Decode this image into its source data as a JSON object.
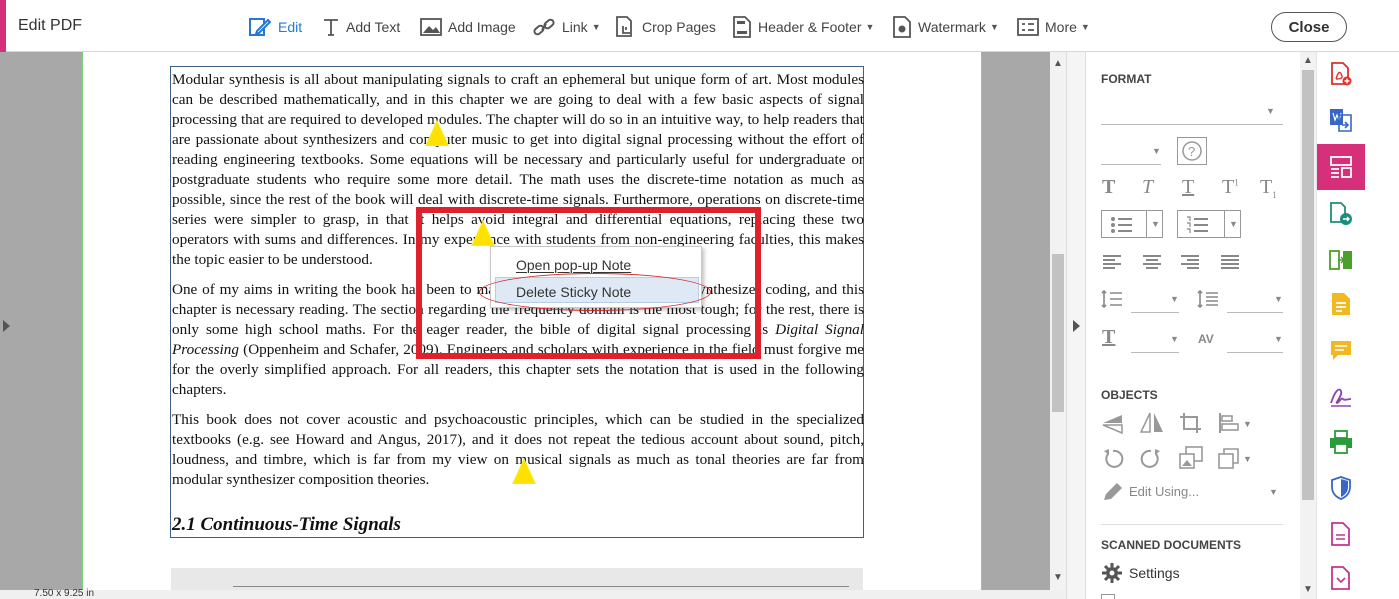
{
  "app": {
    "title": "Edit PDF"
  },
  "toolbar": {
    "edit": "Edit",
    "add_text": "Add Text",
    "add_image": "Add Image",
    "link": "Link",
    "crop_pages": "Crop Pages",
    "header_footer": "Header & Footer",
    "watermark": "Watermark",
    "more": "More",
    "close": "Close"
  },
  "document": {
    "p1": "Modular synthesis is all about manipulating signals to craft an ephemeral but unique form of art. Most modules can be described mathematically, and in this chapter we are going to deal with a few basic aspects of signal processing that are required to developed modules. The chapter will do so in an intuitive way, to help readers that are passionate about synthesizers and computer music to get into digital signal processing without the effort of reading engineering textbooks. Some equations will be necessary and particularly useful for undergraduate or postgraduate students who require some more detail. The math uses the discrete-time notation as much as possible, since the rest of the book will deal with discrete-time signals. Furthermore, operations on discrete-time series were simpler to grasp, in that it helps avoid integral and differential equations, replacing these two operators with sums and differences. In my experience with students from non-engineering faculties, this makes the topic easier to be understood.",
    "p2_before": "One of my aims in writing the book has been to make it easy to enter the world of synthesizer coding, and this chapter is necessary reading. The section regarding the frequency domain is the most tough; for the rest, there is only some high school maths. For the eager reader, the bible of digital signal processing is ",
    "p2_italic": "Digital Signal Processing",
    "p2_after": " (Oppenheim and Schafer, 2009). Engineers and scholars with experience in the field must forgive me for the overly simplified approach. For all readers, this chapter sets the notation that is used in the following chapters.",
    "p3": "This book does not cover acoustic and psychoacoustic principles, which can be studied in the specialized textbooks (e.g. see Howard and Angus, 2017), and it does not repeat the tedious account about sound, pitch, loudness, and timbre, which is far from my view on musical signals as much as tonal theories are far from modular synthesizer composition theories.",
    "heading": "2.1  Continuous-Time Signals"
  },
  "context_menu": {
    "open_note": "Open pop-up Note",
    "delete_note": "Delete Sticky Note"
  },
  "status": {
    "page_size": "7.50 x 9.25 in"
  },
  "panel": {
    "format_title": "FORMAT",
    "objects_title": "OBJECTS",
    "edit_using": "Edit Using...",
    "scanned_title": "SCANNED DOCUMENTS",
    "settings": "Settings"
  },
  "colors": {
    "accent": "#d6307a",
    "edit_blue": "#2679d2",
    "highlight_red": "#e0202a",
    "note_yellow": "#f6ec16"
  }
}
